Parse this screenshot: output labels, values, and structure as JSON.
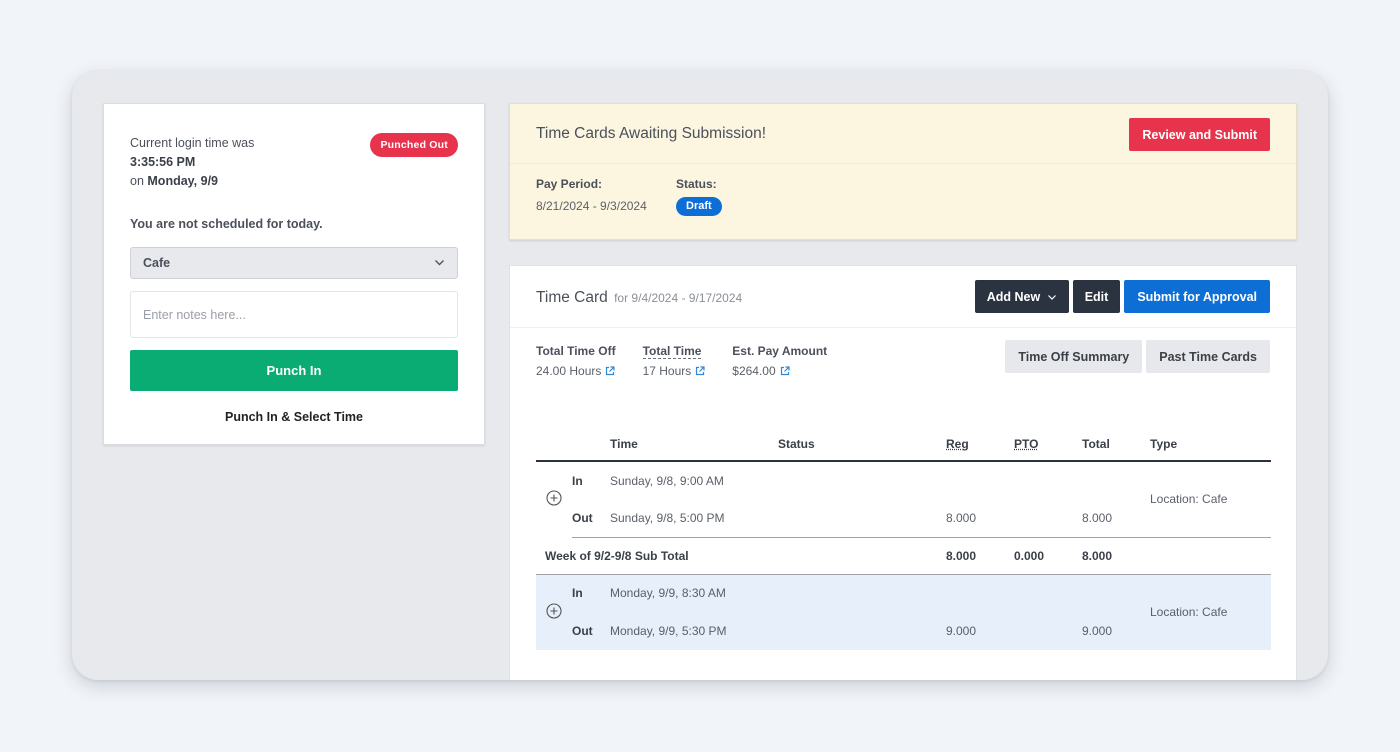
{
  "punch_panel": {
    "login_prefix": "Current login time was",
    "login_time": "3:35:56 PM",
    "on_prefix": "on",
    "login_day": "Monday, 9/9",
    "status_badge": "Punched Out",
    "schedule_note": "You are not scheduled for today.",
    "location_selected": "Cafe",
    "notes_placeholder": "Enter notes here...",
    "notes_value": "",
    "punch_in_label": "Punch In",
    "punch_select_label": "Punch In & Select Time",
    "colors": {
      "punched_out": "#e8334d",
      "punch_in": "#0aac74"
    }
  },
  "awaiting": {
    "title": "Time Cards Awaiting Submission!",
    "review_button": "Review and Submit",
    "pay_period_label": "Pay Period:",
    "pay_period_value": "8/21/2024 - 9/3/2024",
    "status_label": "Status:",
    "status_value": "Draft",
    "colors": {
      "banner": "#fcf6e0",
      "draft": "#0d6fd6"
    }
  },
  "timecard": {
    "title": "Time Card",
    "range": "for 9/4/2024 - 9/17/2024",
    "buttons": {
      "add_new": "Add New",
      "edit": "Edit",
      "submit": "Submit for Approval",
      "time_off_summary": "Time Off Summary",
      "past_time_cards": "Past Time Cards"
    },
    "summary": [
      {
        "label": "Total Time Off",
        "value": "24.00 Hours"
      },
      {
        "label": "Total Time",
        "value": "17 Hours"
      },
      {
        "label": "Est. Pay Amount",
        "value": "$264.00"
      }
    ],
    "columns": [
      "Time",
      "Status",
      "Reg",
      "PTO",
      "Total",
      "Type"
    ],
    "entries": [
      {
        "in_label": "In",
        "in_time": "Sunday, 9/8, 9:00 AM",
        "out_label": "Out",
        "out_time": "Sunday, 9/8, 5:00 PM",
        "status": "",
        "reg": "8.000",
        "pto": "",
        "total": "8.000",
        "type": "Location: Cafe"
      },
      {
        "in_label": "In",
        "in_time": "Monday, 9/9, 8:30 AM",
        "out_label": "Out",
        "out_time": "Monday, 9/9, 5:30 PM",
        "status": "",
        "reg": "9.000",
        "pto": "",
        "total": "9.000",
        "type": "Location: Cafe"
      }
    ],
    "subtotal": {
      "label": "Week of 9/2-9/8 Sub Total",
      "reg": "8.000",
      "pto": "0.000",
      "total": "8.000"
    },
    "colors": {
      "dark_button": "#2b3240",
      "primary": "#0d6fd6",
      "row_highlight": "#e7effa"
    }
  }
}
